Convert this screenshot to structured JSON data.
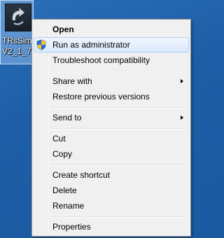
{
  "desktop_icon": {
    "label_line1": "TRsSim",
    "label_line2": "V2_1_7"
  },
  "context_menu": {
    "open": "Open",
    "run_as_admin": "Run as administrator",
    "troubleshoot": "Troubleshoot compatibility",
    "share_with": "Share with",
    "restore_versions": "Restore previous versions",
    "send_to": "Send to",
    "cut": "Cut",
    "copy": "Copy",
    "create_shortcut": "Create shortcut",
    "delete": "Delete",
    "rename": "Rename",
    "properties": "Properties"
  },
  "colors": {
    "desktop": "#1f5fa6",
    "menu_bg": "#f0f0f0",
    "hover_border": "#aecff7"
  }
}
